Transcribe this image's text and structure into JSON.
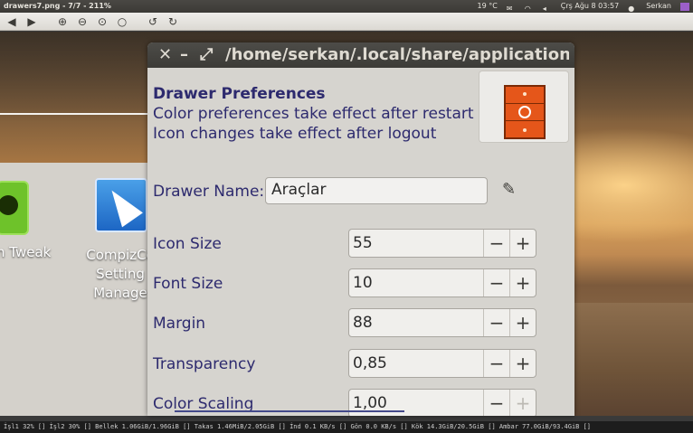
{
  "top_panel": {
    "window_title": "drawers7.png - 7/7 - 211%",
    "temperature": "19 °C",
    "datetime": "Çrş Ağu 8 03:57",
    "user": "Serkan",
    "icons": [
      "wifi-icon",
      "mail-icon",
      "battery-icon",
      "volume-icon",
      "user-icon",
      "power-icon"
    ]
  },
  "toolbar": {
    "buttons": [
      "back-icon",
      "forward-icon",
      "zoom-in-icon",
      "zoom-out-icon",
      "zoom-fit-icon",
      "zoom-original-icon",
      "rotate-left-icon",
      "rotate-right-icon"
    ]
  },
  "desktop": {
    "icon_tweak_label": "n Tweak",
    "icon_compiz_label": [
      "CompizCo",
      "Setting",
      "Manage"
    ]
  },
  "dialog": {
    "title": "/home/serkan/.local/share/applications/A",
    "heading": "Drawer Preferences",
    "note1": "Color preferences take effect after restart",
    "note2": "Icon changes take effect after logout",
    "name_label": "Drawer Name:",
    "name_value": "Araçlar",
    "fields": [
      {
        "label": "Icon Size",
        "value": "55"
      },
      {
        "label": "Font Size",
        "value": "10"
      },
      {
        "label": "Margin",
        "value": "88"
      },
      {
        "label": "Transparency",
        "value": "0,85"
      },
      {
        "label": "Color Scaling",
        "value": "1,00"
      }
    ],
    "minus": "−",
    "plus": "+"
  },
  "statusbar": {
    "text": "İşl1 32% [] İşl2 30% [] Bellek 1.06GiB/1.96GiB [] Takas 1.46MiB/2.05GiB [] İnd 0.1 KB/s [] Gön 0.0 KB/s [] Kök 14.3GiB/20.5GiB [] Ambar 77.0GiB/93.4GiB []"
  },
  "colors": {
    "accent_orange": "#e5561a",
    "label_blue": "#2d2a6e",
    "panel_dark": "#3c3b37"
  }
}
